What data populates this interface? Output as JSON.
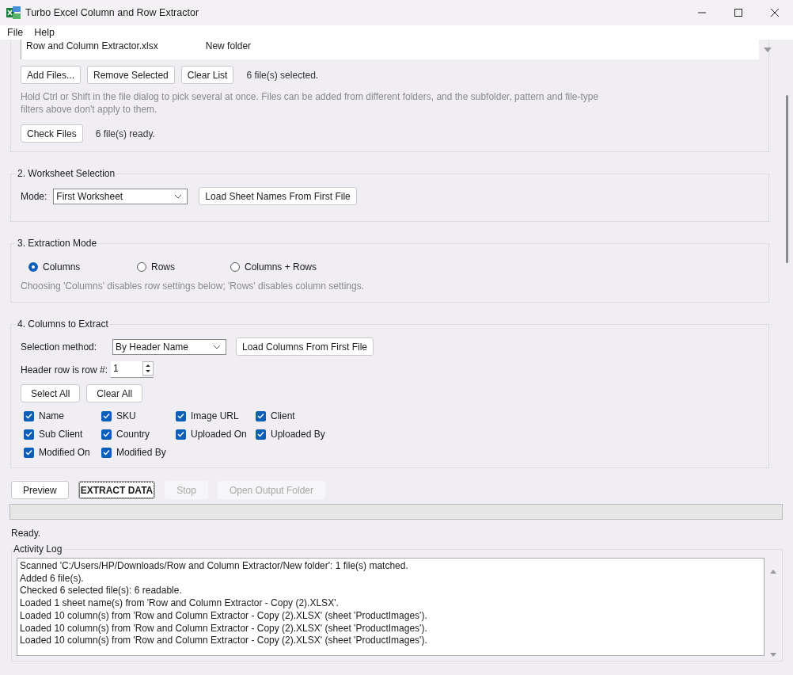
{
  "window": {
    "title": "Turbo Excel Column and Row Extractor"
  },
  "menu": [
    "File",
    "Help"
  ],
  "files_section": {
    "list_row": [
      "Row and Column Extractor.xlsx",
      "New folder"
    ],
    "buttons": [
      "Add Files...",
      "Remove Selected",
      "Clear List"
    ],
    "selected_status": "6 file(s) selected.",
    "hint": "Hold Ctrl or Shift in the file dialog to pick several at once. Files can be added from different folders, and the subfolder, pattern and file-type filters above don't apply to them.",
    "check_button": "Check Files",
    "ready_status": "6 file(s) ready."
  },
  "worksheet_section": {
    "title": "2. Worksheet Selection",
    "mode_label": "Mode:",
    "mode_value": "First Worksheet",
    "load_button": "Load Sheet Names From First File"
  },
  "extraction_section": {
    "title": "3. Extraction Mode",
    "options": [
      {
        "label": "Columns",
        "selected": true
      },
      {
        "label": "Rows",
        "selected": false
      },
      {
        "label": "Columns + Rows",
        "selected": false
      }
    ],
    "hint": "Choosing 'Columns' disables row settings below; 'Rows' disables column settings."
  },
  "columns_section": {
    "title": "4. Columns to Extract",
    "method_label": "Selection method:",
    "method_value": "By Header Name",
    "load_button": "Load Columns From First File",
    "header_row_label": "Header row is row #:",
    "header_row_value": "1",
    "buttons": [
      "Select All",
      "Clear All"
    ],
    "columns": [
      {
        "label": "Name",
        "checked": true
      },
      {
        "label": "SKU",
        "checked": true
      },
      {
        "label": "Image URL",
        "checked": true
      },
      {
        "label": "Client",
        "checked": true
      },
      {
        "label": "Sub Client",
        "checked": true
      },
      {
        "label": "Country",
        "checked": true
      },
      {
        "label": "Uploaded On",
        "checked": true
      },
      {
        "label": "Uploaded By",
        "checked": true
      },
      {
        "label": "Modified On",
        "checked": true
      },
      {
        "label": "Modified By",
        "checked": true
      }
    ]
  },
  "actions": [
    {
      "label": "Preview",
      "disabled": false,
      "focused": false
    },
    {
      "label": "EXTRACT DATA",
      "disabled": false,
      "focused": true
    },
    {
      "label": "Stop",
      "disabled": true,
      "focused": false
    },
    {
      "label": "Open Output Folder",
      "disabled": true,
      "focused": false
    }
  ],
  "progress": {
    "level": 0
  },
  "status": "Ready.",
  "log": {
    "title": "Activity Log",
    "lines": [
      "Scanned 'C:/Users/HP/Downloads/Row and Column Extractor/New folder': 1 file(s) matched.",
      "Added 6 file(s).",
      "Checked 6 selected file(s): 6 readable.",
      "Loaded 1 sheet name(s) from 'Row and Column Extractor - Copy (2).XLSX'.",
      "Loaded 10 column(s) from 'Row and Column Extractor - Copy (2).XLSX' (sheet 'ProductImages').",
      "Loaded 10 column(s) from 'Row and Column Extractor - Copy (2).XLSX' (sheet 'ProductImages').",
      "Loaded 10 column(s) from 'Row and Column Extractor - Copy (2).XLSX' (sheet 'ProductImages')."
    ]
  }
}
